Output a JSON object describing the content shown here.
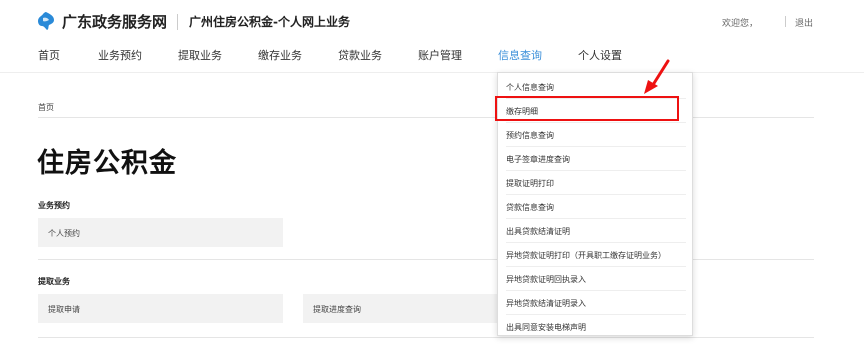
{
  "header": {
    "site_name": "广东政务服务网",
    "sub_title": "广州住房公积金-个人网上业务",
    "welcome": "欢迎您，",
    "logout": "退出"
  },
  "nav": {
    "items": [
      "首页",
      "业务预约",
      "提取业务",
      "缴存业务",
      "贷款业务",
      "账户管理",
      "信息查询",
      "个人设置"
    ],
    "active": "信息查询"
  },
  "breadcrumb": "首页",
  "page_title": "住房公积金",
  "sections": [
    {
      "label": "业务预约",
      "items": [
        "个人预约"
      ]
    },
    {
      "label": "提取业务",
      "items": [
        "提取申请",
        "提取进度查询"
      ]
    }
  ],
  "dropdown": {
    "items": [
      "个人信息查询",
      "缴存明细",
      "预约信息查询",
      "电子签章进度查询",
      "提取证明打印",
      "贷款信息查询",
      "出具贷款结清证明",
      "异地贷款证明打印（开具职工缴存证明业务）",
      "异地贷款证明回执录入",
      "异地贷款结清证明录入",
      "出具同意安装电梯声明"
    ],
    "highlighted": "缴存明细"
  },
  "colors": {
    "accent": "#3b8fd9",
    "highlight": "#e11111",
    "logo": "#2a8ad8"
  }
}
